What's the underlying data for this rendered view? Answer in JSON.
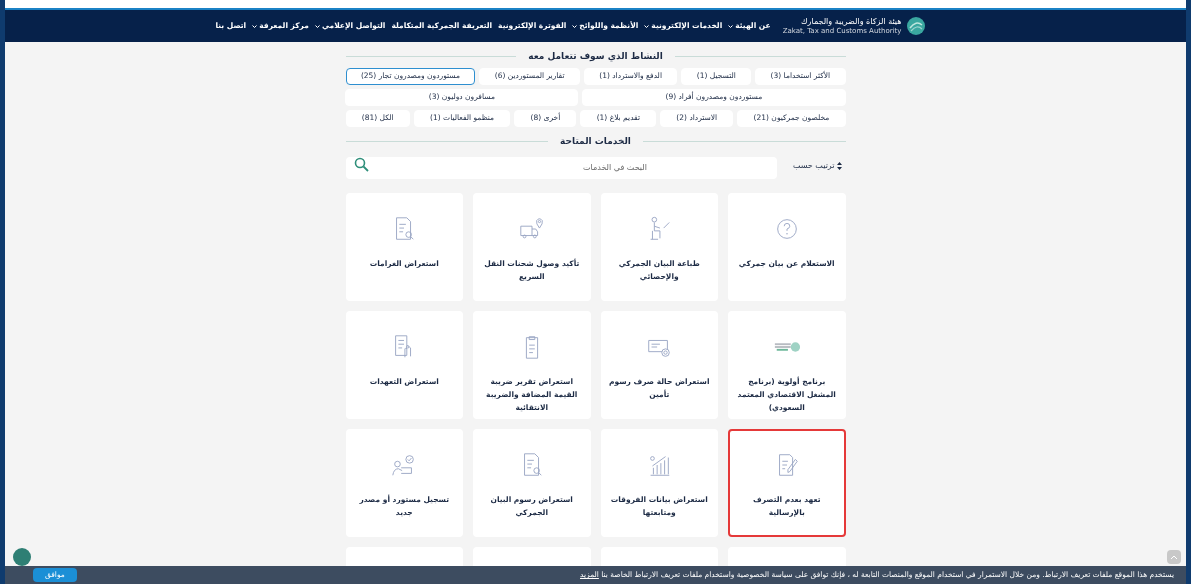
{
  "header": {
    "org_name_ar": "هيئة الزكاة والضريبة والجمارك",
    "org_name_en": "Zakat, Tax and Customs Authority",
    "menu": [
      {
        "label": "عن الهيئة",
        "dropdown": true
      },
      {
        "label": "الخدمات الإلكترونية",
        "dropdown": true
      },
      {
        "label": "الأنظمة واللوائح",
        "dropdown": true
      },
      {
        "label": "الفوترة الإلكترونية",
        "dropdown": false
      },
      {
        "label": "التعريفة الجمركية المتكاملة",
        "dropdown": false
      },
      {
        "label": "التواصل الإعلامي",
        "dropdown": true
      },
      {
        "label": "مركز المعرفة",
        "dropdown": true
      },
      {
        "label": "اتصل بنا",
        "dropdown": false
      }
    ]
  },
  "activity": {
    "title": "النشاط الذي سوف تتعامل معه",
    "filter_rows": [
      {
        "chips": [
          {
            "label": "الأكثر استخداما (3)",
            "selected": false
          },
          {
            "label": "التسجيل (1)",
            "selected": false
          },
          {
            "label": "الدفع والاسترداد (1)",
            "selected": false
          },
          {
            "label": "تقارير المستوردين (6)",
            "selected": false
          },
          {
            "label": "مستوردون ومصدرون تجار (25)",
            "selected": true
          },
          {
            "label": "مستوردون ومصدرون أفراد (9)",
            "selected": false
          },
          {
            "label": "مسافرون دوليون (3)",
            "selected": false
          }
        ]
      },
      {
        "chips": [
          {
            "label": "مخلصون جمركيون (21)",
            "selected": false
          },
          {
            "label": "الاسترداد (2)",
            "selected": false
          },
          {
            "label": "تقديم بلاغ (1)",
            "selected": false
          },
          {
            "label": "أخرى (8)",
            "selected": false
          },
          {
            "label": "منظمو الفعاليات (1)",
            "selected": false
          },
          {
            "label": "الكل (81)",
            "selected": false
          }
        ]
      }
    ]
  },
  "services": {
    "title": "الخدمات المتاحة",
    "sort_label": "ترتيب حسب",
    "search": {
      "placeholder": "البحث في الخدمات"
    },
    "cards": [
      {
        "title": "الاستعلام عن بيان جمركي",
        "highlighted": false
      },
      {
        "title": "طباعة البيان الجمركي والإحصائي",
        "highlighted": false
      },
      {
        "title": "تأكيد وصول شحنات النقل السريع",
        "highlighted": false
      },
      {
        "title": "استعراض الغرامات",
        "highlighted": false
      },
      {
        "title": "برنامج أولوية (برنامج المشغل الاقتصادي المعتمد السعودي)",
        "highlighted": false
      },
      {
        "title": "استعراض حالة صرف رسوم تأمين",
        "highlighted": false
      },
      {
        "title": "استعراض تقرير ضريبة القيمة المضافة والضريبة الانتقائية",
        "highlighted": false
      },
      {
        "title": "استعراض التعهدات",
        "highlighted": false
      },
      {
        "title": "تعهد بعدم التصرف بالإرسالية",
        "highlighted": true
      },
      {
        "title": "استعراض بيانات الفروقات ومتابعتها",
        "highlighted": false
      },
      {
        "title": "استعراض رسوم البيان الجمركي",
        "highlighted": false
      },
      {
        "title": "تسجيل مستورد أو مصدر جديد",
        "highlighted": false
      }
    ]
  },
  "cookie_bar": {
    "text": "يستخدم هذا الموقع ملفات تعريف الارتباط. ومن خلال الاستمرار في استخدام الموقع والمنصات التابعة له ، فإنك توافق على سياسة الخصوصية واستخدام ملفات تعريف الارتباط الخاصة بنا",
    "link": "المزيد",
    "accept": "موافق"
  }
}
